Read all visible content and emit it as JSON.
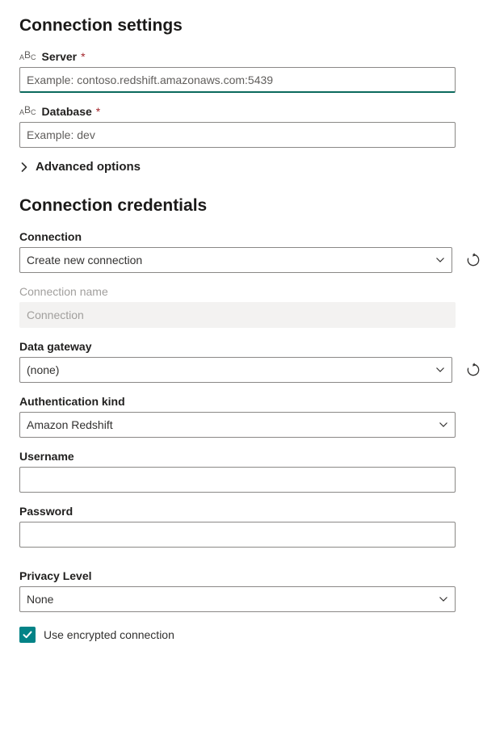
{
  "settings": {
    "title": "Connection settings",
    "server": {
      "label": "Server",
      "required": "*",
      "placeholder": "Example: contoso.redshift.amazonaws.com:5439",
      "value": ""
    },
    "database": {
      "label": "Database",
      "required": "*",
      "placeholder": "Example: dev",
      "value": ""
    },
    "advanced": {
      "label": "Advanced options"
    }
  },
  "credentials": {
    "title": "Connection credentials",
    "connection": {
      "label": "Connection",
      "value": "Create new connection"
    },
    "connection_name": {
      "label": "Connection name",
      "value": "Connection"
    },
    "data_gateway": {
      "label": "Data gateway",
      "value": "(none)"
    },
    "auth_kind": {
      "label": "Authentication kind",
      "value": "Amazon Redshift"
    },
    "username": {
      "label": "Username",
      "value": ""
    },
    "password": {
      "label": "Password",
      "value": ""
    },
    "privacy": {
      "label": "Privacy Level",
      "value": "None"
    },
    "encrypted": {
      "label": "Use encrypted connection",
      "checked": true
    }
  }
}
